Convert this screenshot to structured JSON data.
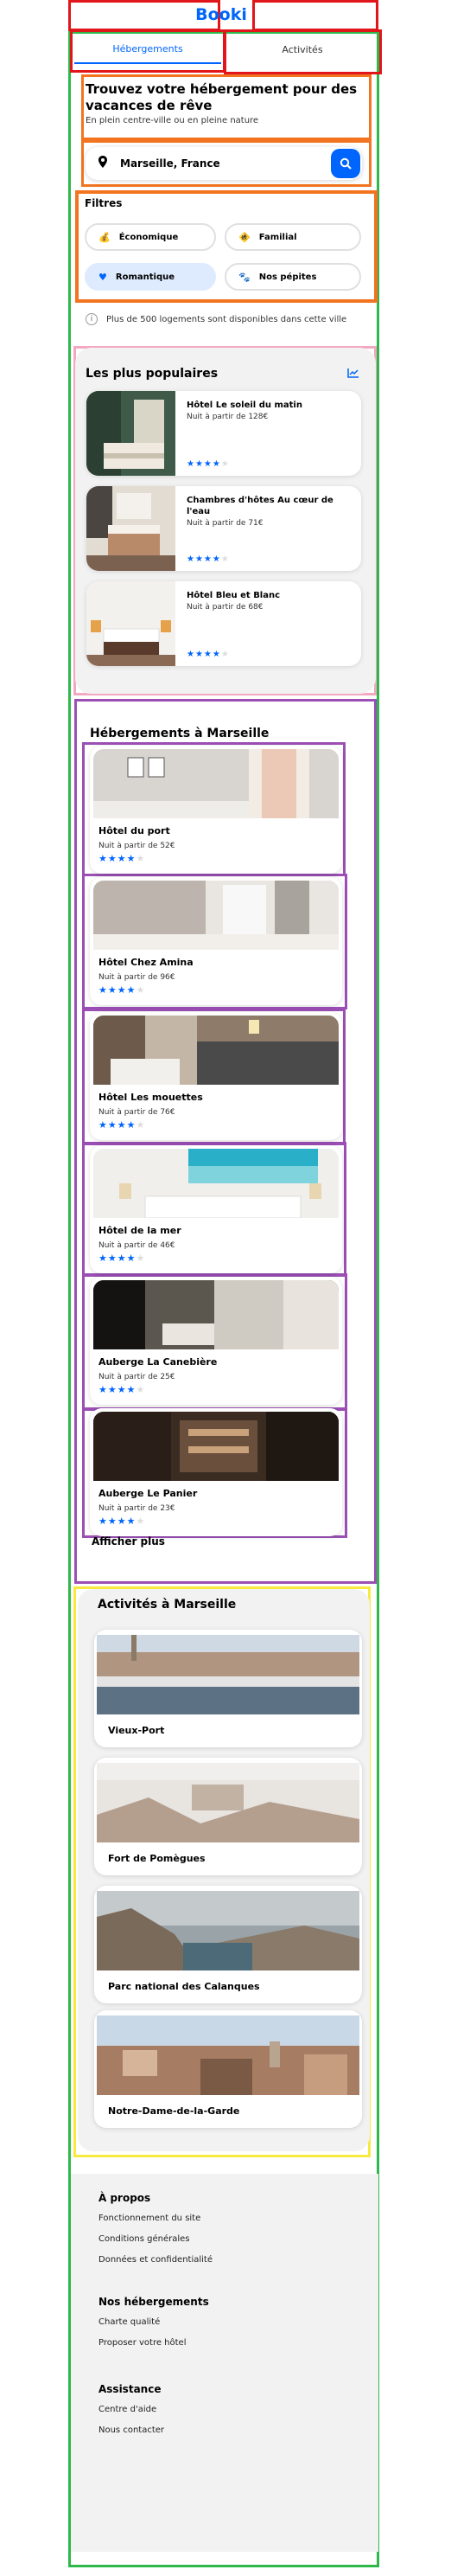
{
  "header": {
    "logo": "Booki",
    "tabs": [
      {
        "label": "Hébergements",
        "active": true
      },
      {
        "label": "Activités",
        "active": false
      }
    ]
  },
  "hero": {
    "title": "Trouvez votre hébergement pour des vacances de rêve",
    "subtitle": "En plein centre-ville ou en pleine nature"
  },
  "search": {
    "value": "Marseille, France",
    "location_icon": "location-pin-icon",
    "button_icon": "search-icon"
  },
  "filters": {
    "title": "Filtres",
    "items": [
      {
        "label": "Économique",
        "icon": "money-icon",
        "active": false
      },
      {
        "label": "Familial",
        "icon": "child-icon",
        "active": false
      },
      {
        "label": "Romantique",
        "icon": "heart-icon",
        "active": true
      },
      {
        "label": "Nos pépites",
        "icon": "dog-icon",
        "active": false
      }
    ]
  },
  "info": {
    "text": "Plus de 500 logements sont disponibles dans cette ville"
  },
  "popular": {
    "title": "Les plus populaires",
    "icon": "trend-chart-icon",
    "items": [
      {
        "name": "Hôtel Le soleil du matin",
        "price": "Nuit à partir de 128€",
        "rating": 4
      },
      {
        "name": "Chambres d'hôtes Au cœur de l'eau",
        "price": "Nuit à partir de 71€",
        "rating": 4
      },
      {
        "name": "Hôtel Bleu et Blanc",
        "price": "Nuit à partir de 68€",
        "rating": 4
      }
    ]
  },
  "hebergements": {
    "title": "Hébergements à Marseille",
    "items": [
      {
        "name": "Hôtel du port",
        "price": "Nuit à partir de 52€",
        "rating": 4
      },
      {
        "name": "Hôtel Chez Amina",
        "price": "Nuit à partir de 96€",
        "rating": 4
      },
      {
        "name": "Hôtel Les mouettes",
        "price": "Nuit à partir de 76€",
        "rating": 4
      },
      {
        "name": "Hôtel de la mer",
        "price": "Nuit à partir de 46€",
        "rating": 4
      },
      {
        "name": "Auberge La Canebière",
        "price": "Nuit à partir de 25€",
        "rating": 4
      },
      {
        "name": "Auberge Le Panier",
        "price": "Nuit à partir de 23€",
        "rating": 4
      }
    ],
    "more_label": "Afficher plus"
  },
  "activites": {
    "title": "Activités à Marseille",
    "items": [
      {
        "name": "Vieux-Port"
      },
      {
        "name": "Fort de Pomègues"
      },
      {
        "name": "Parc national des Calanques"
      },
      {
        "name": "Notre-Dame-de-la-Garde"
      }
    ]
  },
  "footer": {
    "sections": [
      {
        "title": "À propos",
        "links": [
          "Fonctionnement du site",
          "Conditions générales",
          "Données et confidentialité"
        ]
      },
      {
        "title": "Nos hébergements",
        "links": [
          "Charte qualité",
          "Proposer votre hôtel"
        ]
      },
      {
        "title": "Assistance",
        "links": [
          "Centre d'aide",
          "Nous contacter"
        ]
      }
    ]
  },
  "colors": {
    "brand": "#0065fc",
    "chip_active": "#deebff",
    "section_bg": "#f2f2f2"
  }
}
